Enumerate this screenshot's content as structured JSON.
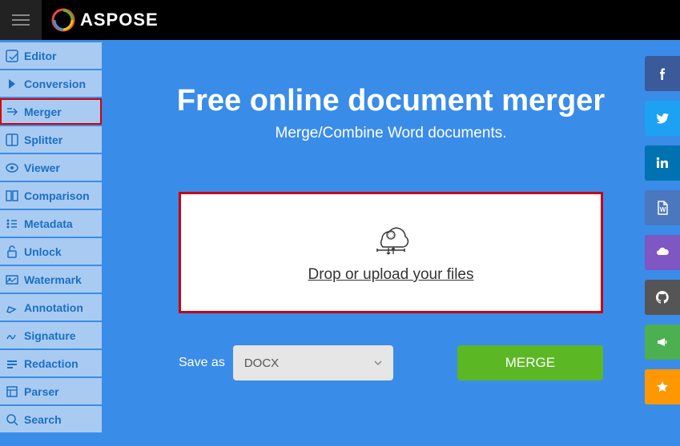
{
  "header": {
    "brand": "ASPOSE"
  },
  "sidebar": {
    "items": [
      {
        "label": "Editor",
        "icon": "editor"
      },
      {
        "label": "Conversion",
        "icon": "conversion"
      },
      {
        "label": "Merger",
        "icon": "merger",
        "selected": true
      },
      {
        "label": "Splitter",
        "icon": "splitter"
      },
      {
        "label": "Viewer",
        "icon": "viewer"
      },
      {
        "label": "Comparison",
        "icon": "comparison"
      },
      {
        "label": "Metadata",
        "icon": "metadata"
      },
      {
        "label": "Unlock",
        "icon": "unlock"
      },
      {
        "label": "Watermark",
        "icon": "watermark"
      },
      {
        "label": "Annotation",
        "icon": "annotation"
      },
      {
        "label": "Signature",
        "icon": "signature"
      },
      {
        "label": "Redaction",
        "icon": "redaction"
      },
      {
        "label": "Parser",
        "icon": "parser"
      },
      {
        "label": "Search",
        "icon": "search"
      }
    ]
  },
  "content": {
    "title": "Free online document merger",
    "subtitle": "Merge/Combine Word documents.",
    "dropzone_label": "Drop or upload your files",
    "save_label": "Save as",
    "save_format": "DOCX",
    "merge_button": "MERGE"
  },
  "social": [
    {
      "name": "facebook"
    },
    {
      "name": "twitter"
    },
    {
      "name": "linkedin"
    },
    {
      "name": "word"
    },
    {
      "name": "cloud"
    },
    {
      "name": "github"
    },
    {
      "name": "megaphone"
    },
    {
      "name": "star"
    }
  ]
}
